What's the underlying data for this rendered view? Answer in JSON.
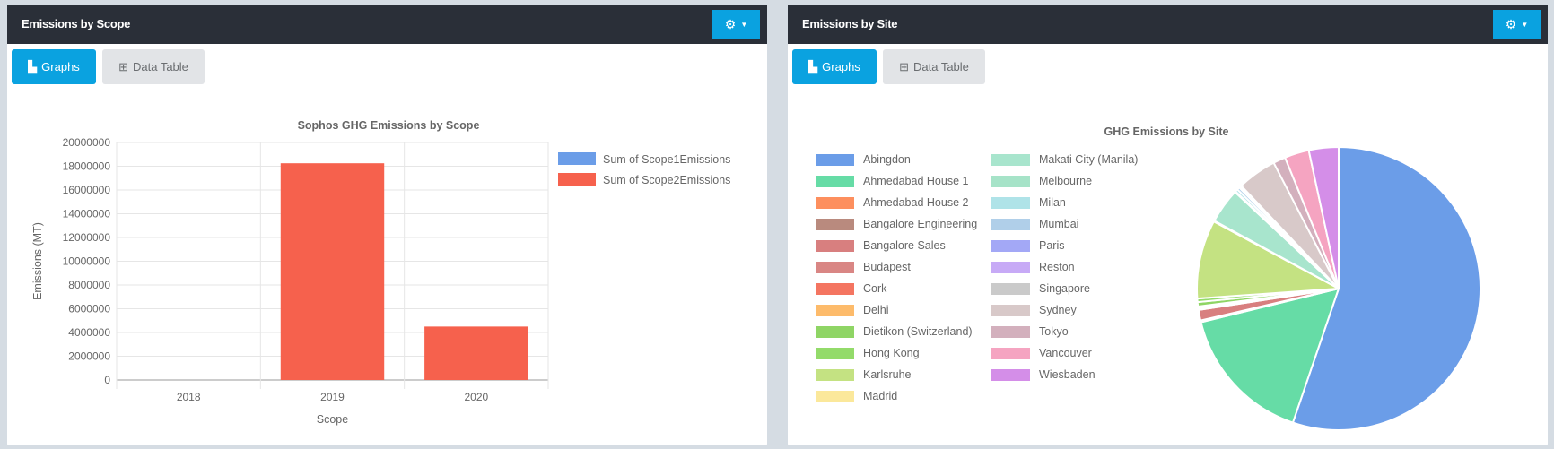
{
  "panels": [
    {
      "title": "Emissions by Scope",
      "graphs_label": "Graphs",
      "table_label": "Data Table",
      "settings_icon": "gear-icon"
    },
    {
      "title": "Emissions by Site",
      "graphs_label": "Graphs",
      "table_label": "Data Table",
      "settings_icon": "gear-icon"
    }
  ],
  "colors": {
    "header": "#2a2f38",
    "accent": "#0aa2e0"
  },
  "chart_data": [
    {
      "type": "bar",
      "title": "Sophos GHG Emissions by Scope",
      "xlabel": "Scope",
      "ylabel": "Emissions (MT)",
      "categories": [
        "2018",
        "2019",
        "2020"
      ],
      "ylim": [
        0,
        20000000
      ],
      "yticks": [
        "0",
        "2000000",
        "4000000",
        "6000000",
        "8000000",
        "10000000",
        "12000000",
        "14000000",
        "16000000",
        "18000000",
        "20000000"
      ],
      "grid": true,
      "legend": "right",
      "series": [
        {
          "name": "Sum of Scope1Emissions",
          "color": "#6b9de8",
          "values": [
            0,
            0,
            0
          ]
        },
        {
          "name": "Sum of Scope2Emissions",
          "color": "#f6614d",
          "values": [
            0,
            18250000,
            4500000
          ]
        }
      ]
    },
    {
      "type": "pie",
      "title": "GHG Emissions by Site",
      "legend": "left",
      "labels": [
        "Abingdon",
        "Ahmedabad House 1",
        "Ahmedabad House 2",
        "Bangalore Engineering",
        "Bangalore Sales",
        "Budapest",
        "Cork",
        "Delhi",
        "Dietikon (Switzerland)",
        "Hong Kong",
        "Karlsruhe",
        "Madrid",
        "Makati City (Manila)",
        "Melbourne",
        "Milan",
        "Mumbai",
        "Paris",
        "Reston",
        "Singapore",
        "Sydney",
        "Tokyo",
        "Vancouver",
        "Wiesbaden"
      ],
      "values": [
        55.4,
        16.0,
        0.1,
        0.1,
        1.2,
        0.2,
        0.1,
        0.1,
        0.5,
        0.4,
        9.0,
        0.1,
        4.0,
        0.1,
        0.3,
        0.3,
        0.1,
        0.1,
        0.1,
        4.5,
        1.4,
        2.8,
        3.4
      ],
      "colors": [
        "#6b9de8",
        "#66dca6",
        "#fd8f5e",
        "#b98a7e",
        "#d87f7f",
        "#d98684",
        "#f47561",
        "#fdbb6b",
        "#8fd565",
        "#93db6a",
        "#c4e282",
        "#fbe89b",
        "#a8e5cd",
        "#a6e3c8",
        "#afe3e8",
        "#b0cfe9",
        "#a3a8f6",
        "#c7aaf6",
        "#cacaca",
        "#d8c9c9",
        "#d3b0bd",
        "#f5a4c1",
        "#d48ee8"
      ]
    }
  ]
}
